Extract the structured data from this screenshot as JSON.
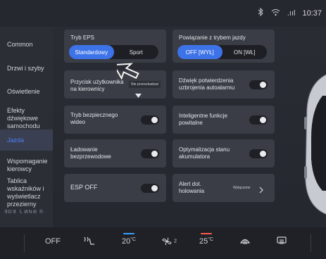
{
  "status": {
    "bluetooth_icon": "bluetooth-icon",
    "wifi_icon": "wifi-icon",
    "signal": ".ııl",
    "time": "10:37"
  },
  "sidebar": {
    "items": [
      {
        "label": "Common"
      },
      {
        "label": "Drzwi i szyby"
      },
      {
        "label": "Oświetlenie"
      },
      {
        "label": "Efekty dźwiękowe samochodu"
      },
      {
        "label": "Jazda"
      },
      {
        "label": "Wspomaganie kierowcy"
      },
      {
        "label": "Tablica wskaźników i wyświetlacz przezierny"
      }
    ],
    "logo": "ƎDƎ ＬͶNƏ ®"
  },
  "eps": {
    "title": "Tryb EPS",
    "options": [
      "Standardowy",
      "Sport"
    ],
    "selected": "Standardowy"
  },
  "drive_link": {
    "title": "Powiązanie z trybem jazdy",
    "options": [
      "OFF [WYŁ]",
      "ON [WŁ]"
    ],
    "selected": "OFF [WYŁ]"
  },
  "cards": {
    "user_button": {
      "label": "Przycisk użytkownika na kierownicy",
      "value": "Nie przeszkadzać"
    },
    "alarm_sound": {
      "label": "Dźwięk potwierdzenia uzbrojenia autoalarmu"
    },
    "safe_mode": {
      "label": "Tryb bezpiecznego wideo"
    },
    "smart_welcome": {
      "label": "Inteligentne funkcje powitalne"
    },
    "wireless_charge": {
      "label": "Ładowanie bezprzewodowe"
    },
    "battery_opt": {
      "label": "Optymalizacja stanu akumulatora"
    },
    "esp": {
      "label": "ESP OFF"
    },
    "hold_alert": {
      "label": "Alert dot. holowania",
      "value": "Wyłączone"
    }
  },
  "climate": {
    "off": "OFF",
    "seat_heat_icon": "seat-heat-icon",
    "left_temp": "20",
    "fan_icon": "fan-icon",
    "fan_level": "2",
    "right_temp": "25",
    "defrost_front_icon": "defrost-front-icon",
    "defrost_rear_icon": "defrost-rear-icon",
    "unit": "°C",
    "left_accent": "#3aa0ff",
    "right_accent": "#ff5a4a"
  },
  "accent": "#3d73e8"
}
